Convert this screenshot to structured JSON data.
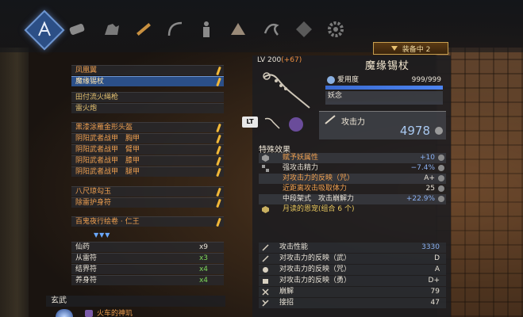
{
  "categories": [
    {
      "name": "weapon",
      "icon": "ninja-weapon-icon",
      "active": true
    },
    {
      "name": "secondary",
      "icon": "scroll-icon",
      "active": false
    },
    {
      "name": "horse",
      "icon": "horse-icon",
      "active": false
    },
    {
      "name": "gun",
      "icon": "rifle-icon",
      "active": false
    },
    {
      "name": "bow",
      "icon": "bow-icon",
      "active": false
    },
    {
      "name": "armor",
      "icon": "armor-body-icon",
      "active": false
    },
    {
      "name": "guardian",
      "icon": "guardian-spirit-icon",
      "active": false
    },
    {
      "name": "dragon",
      "icon": "dragon-icon",
      "active": false
    },
    {
      "name": "accessory",
      "icon": "crest-icon",
      "active": false
    },
    {
      "name": "settings",
      "icon": "gear-icon",
      "active": false
    }
  ],
  "equipped_badge": "装备中 2",
  "left_list": {
    "weapons": [
      {
        "label": "凤凰翼",
        "selected": false,
        "pen": true
      },
      {
        "label": "魔缘锡杖",
        "selected": true,
        "pen": true
      }
    ],
    "ranged": [
      {
        "label": "田付流火绳枪",
        "pen": false
      },
      {
        "label": "雷火炮",
        "pen": false
      }
    ],
    "armor": [
      {
        "label": "黑漆涂雁金形头盔",
        "pen": true
      },
      {
        "label": "阴阳武者战甲　胸甲",
        "pen": true
      },
      {
        "label": "阴阳武者战甲　臂甲",
        "pen": true
      },
      {
        "label": "阴阳武者战甲　膝甲",
        "pen": true
      },
      {
        "label": "阴阳武者战甲　腿甲",
        "pen": true
      }
    ],
    "accessories": [
      {
        "label": "八尺琼勾玉",
        "pen": true
      },
      {
        "label": "除雷护身符",
        "pen": true
      }
    ],
    "scroll": {
      "label": "百鬼夜行绘卷 · 仁王",
      "pen": true
    },
    "gems": "▼▼▼",
    "items": [
      {
        "label": "仙药",
        "count": "x9",
        "green": false
      },
      {
        "label": "从雷符",
        "count": "x3",
        "green": true
      },
      {
        "label": "结界符",
        "count": "x4",
        "green": true
      },
      {
        "label": "养身符",
        "count": "x4",
        "green": true
      }
    ],
    "guardian_label": "玄武",
    "bottom_item": "火车的神玑"
  },
  "weapon": {
    "level": "LV 200",
    "level_bonus": "(+67)",
    "name": "魔缘锡杖",
    "affinity_label": "爱用度",
    "affinity_value": "999/999",
    "affinity_fraction": 1.0,
    "yaonen_label": "妖念",
    "lt_label": "LT",
    "attack_label": "攻击力",
    "attack_value": "4978"
  },
  "special_effects": {
    "title": "特殊效果",
    "rows": [
      {
        "name": "赋予妖属性",
        "value": "+10",
        "color": "orange"
      },
      {
        "name": "强攻击精力",
        "value": "−7.4%",
        "color": "blue"
      },
      {
        "name": "对攻击力的反映（咒）",
        "value": "A+",
        "color": "orange"
      },
      {
        "name": "近距离攻击吸取体力",
        "value": "25",
        "color": "orange"
      },
      {
        "name": "中段架式　攻击崩解力",
        "value": "+22.9%",
        "color": "blue"
      },
      {
        "name": "月读的恩宠(组合 6 个)",
        "value": "",
        "color": "yellow"
      }
    ]
  },
  "stats": [
    {
      "name": "攻击性能",
      "value": "3330",
      "color": "blue"
    },
    {
      "name": "对攻击力的反映（武）",
      "value": "D",
      "color": "white"
    },
    {
      "name": "对攻击力的反映（咒）",
      "value": "A",
      "color": "white"
    },
    {
      "name": "对攻击力的反映（勇）",
      "value": "D+",
      "color": "white"
    },
    {
      "name": "崩解",
      "value": "79",
      "color": "white"
    },
    {
      "name": "接招",
      "value": "47",
      "color": "white"
    }
  ]
}
